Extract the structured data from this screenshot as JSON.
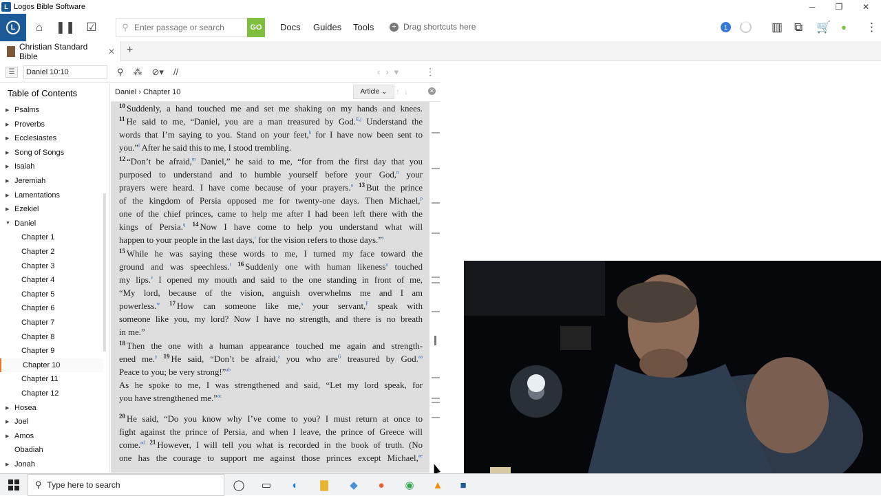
{
  "window": {
    "title": "Logos Bible Software",
    "min": "─",
    "restore": "❐",
    "close": "✕"
  },
  "toolbar": {
    "logo_glyph": "L",
    "search_placeholder": "Enter passage or search",
    "go_label": "GO",
    "links": [
      "Docs",
      "Guides",
      "Tools"
    ],
    "drag_shortcuts": "Drag shortcuts here",
    "notifications": "1"
  },
  "tab": {
    "label": "Christian Standard Bible",
    "close": "✕",
    "add": "+"
  },
  "panel": {
    "reference": "Daniel 10:10",
    "menu_glyph": "☰",
    "divider_glyph": "//"
  },
  "toc": {
    "title": "Table of Contents",
    "items": [
      {
        "label": "Psalms",
        "arrow": "▶"
      },
      {
        "label": "Proverbs",
        "arrow": "▶"
      },
      {
        "label": "Ecclesiastes",
        "arrow": "▶"
      },
      {
        "label": "Song of Songs",
        "arrow": "▶"
      },
      {
        "label": "Isaiah",
        "arrow": "▶"
      },
      {
        "label": "Jeremiah",
        "arrow": "▶"
      },
      {
        "label": "Lamentations",
        "arrow": "▶"
      },
      {
        "label": "Ezekiel",
        "arrow": "▶"
      },
      {
        "label": "Daniel",
        "arrow": "▼"
      },
      {
        "label": "Chapter 1"
      },
      {
        "label": "Chapter 2"
      },
      {
        "label": "Chapter 3"
      },
      {
        "label": "Chapter 4"
      },
      {
        "label": "Chapter 5"
      },
      {
        "label": "Chapter 6"
      },
      {
        "label": "Chapter 7"
      },
      {
        "label": "Chapter 8"
      },
      {
        "label": "Chapter 9"
      },
      {
        "label": "Chapter 10",
        "selected": true
      },
      {
        "label": "Chapter 11"
      },
      {
        "label": "Chapter 12"
      },
      {
        "label": "Hosea",
        "arrow": "▶"
      },
      {
        "label": "Joel",
        "arrow": "▶"
      },
      {
        "label": "Amos",
        "arrow": "▶"
      },
      {
        "label": "Obadiah"
      },
      {
        "label": "Jonah",
        "arrow": "▶"
      }
    ]
  },
  "content": {
    "breadcrumb": [
      "Daniel",
      "Chapter 10"
    ],
    "view_mode": "Article",
    "lines": [
      {
        "v": "10",
        "t": "Suddenly, a hand touched me and set me shaking on my hands and knees."
      },
      {
        "v": "11",
        "t": "He said to me, “Daniel, you are a man treasured by God.",
        "n": "E,j",
        "t2": " Understand the"
      },
      {
        "t": "words that I’m saying to you. Stand on your feet,",
        "n": "k",
        "t2": " for I have now been sent to"
      },
      {
        "t": "you.”",
        "n": "l",
        "t2": " After he said this to me, I stood trembling.",
        "last": true
      },
      {
        "v": "12",
        "t": "“Don’t be afraid,",
        "n": "m",
        "t2": " Daniel,” he said to me, “for from the first day that you"
      },
      {
        "t": "purposed to understand and to humble yourself before your God,",
        "n": "n",
        "t2": " your"
      },
      {
        "t": "prayers were heard. I have come because of your prayers.",
        "n": "o",
        "v2": "13",
        "t2": "But the prince"
      },
      {
        "t": "of the kingdom of Persia opposed me for twenty-one days. Then Michael,",
        "n": "p"
      },
      {
        "t": "one of the chief princes, came to help me after I had been left there with the"
      },
      {
        "t": "kings of Persia.",
        "n": "q",
        "v2": "14",
        "t2": "Now I have come to help you understand what will"
      },
      {
        "t": "happen to your people in the last days,",
        "n": "r",
        "t2": " for the vision refers to those days.”",
        "n2": "s",
        "last": true
      },
      {
        "v": "15",
        "t": "While he was saying these words to me, I turned my face toward the"
      },
      {
        "t": "ground and was speechless.",
        "n": "t",
        "v2": "16",
        "t2": "Suddenly one with human likeness",
        "n2": "u",
        "t3": " touched"
      },
      {
        "t": "my lips.",
        "n": "v",
        "t2": " I opened my mouth and said to the one standing in front of me,"
      },
      {
        "t": "“My lord, because of the vision, anguish overwhelms me and I am"
      },
      {
        "t": "powerless.",
        "n": "w",
        "v2": "17",
        "t2": "How can someone like me,",
        "n2": "x",
        "t3": " your servant,",
        "n3": "F",
        "t4": " speak with"
      },
      {
        "t": "someone like you, my lord? Now I have no strength, and there is no breath"
      },
      {
        "t": "in me.”",
        "last": true
      },
      {
        "v": "18",
        "t": "Then the one with a human appearance touched me again and strength-"
      },
      {
        "t": "ened me.",
        "n": "y",
        "v2": "19",
        "t2": "He said, “Don’t be afraid,",
        "n2": "z",
        "t3": " you who are",
        "n3": "G",
        "t4": " treasured by God.",
        "n4": "aa"
      },
      {
        "t": "Peace to you; be very strong!”",
        "n": "ab",
        "last": true
      },
      {
        "t": "   As he spoke to me, I was strengthened and said, “Let my lord speak, for"
      },
      {
        "t": "you have strengthened me.”",
        "n": "ac",
        "last": true
      },
      {
        "v": "20",
        "t": "He said, “Do you know why I’ve come to you? I must return at once to"
      },
      {
        "t": "fight against the prince of Persia, and when I leave, the prince of Greece will"
      },
      {
        "t": "come.",
        "n": "ad",
        "v2": "21",
        "t2": "However, I will tell you what is recorded in the book of truth. (No"
      },
      {
        "t": "one has the courage to support me against those princes except Michael,",
        "n": "ae"
      }
    ]
  },
  "taskbar": {
    "search_label": "Type here to search",
    "start_glyph": "⊞",
    "search_glyph": "⚲",
    "apps": [
      "cortana-icon",
      "task-view-icon",
      "edge-icon",
      "file-explorer-icon",
      "app-icon",
      "firefox-icon",
      "chrome-icon",
      "vlc-icon",
      "logos-taskbar-icon"
    ]
  }
}
